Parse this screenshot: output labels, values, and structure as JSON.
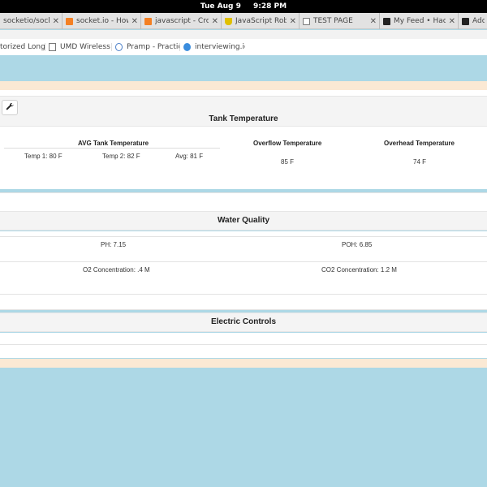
{
  "system_bar": {
    "date": "Tue Aug  9",
    "time": "9:28 PM"
  },
  "tabs": [
    {
      "title": "socketio/socket.i",
      "icon": "github-icon",
      "color": "#333333"
    },
    {
      "title": "socket.io - How t",
      "icon": "stackoverflow-icon",
      "color": "#f48024"
    },
    {
      "title": "javascript - Cross",
      "icon": "stackoverflow-icon",
      "color": "#f48024"
    },
    {
      "title": "JavaScript Robot",
      "icon": "robot-icon",
      "color": "#e0c000"
    },
    {
      "title": "TEST PAGE",
      "icon": "page-icon",
      "color": "#ffffff"
    },
    {
      "title": "My Feed • Hacke",
      "icon": "hackernews-icon",
      "color": "#222222"
    },
    {
      "title": "Add",
      "icon": "hackernews-icon",
      "color": "#222222"
    }
  ],
  "bookmarks": [
    {
      "label": "torized Longt",
      "icon": "none"
    },
    {
      "label": "UMD Wireless Au",
      "icon": "page-icon"
    },
    {
      "label": "Pramp - Practice",
      "icon": "check-circle-icon"
    },
    {
      "label": "interviewing.io -",
      "icon": "interviewing-icon"
    }
  ],
  "tank": {
    "title": "Tank Temperature",
    "avg_title": "AVG Tank Temperature",
    "temp1": "Temp 1: 80 F",
    "temp2": "Temp 2: 82 F",
    "avg": "Avg: 81 F",
    "overflow_title": "Overflow Temperature",
    "overflow_value": "85 F",
    "overhead_title": "Overhead Temperature",
    "overhead_value": "74 F"
  },
  "water": {
    "title": "Water Quality",
    "ph": "PH: 7.15",
    "poh": "POH: 6.85",
    "o2": "O2 Concentration: .4 M",
    "co2": "CO2 Concentration: 1.2 M"
  },
  "electric": {
    "title": "Electric Controls"
  },
  "colors": {
    "background": "#add8e6",
    "band": "#fbe9d4",
    "header_strip": "#f4f4f4"
  }
}
